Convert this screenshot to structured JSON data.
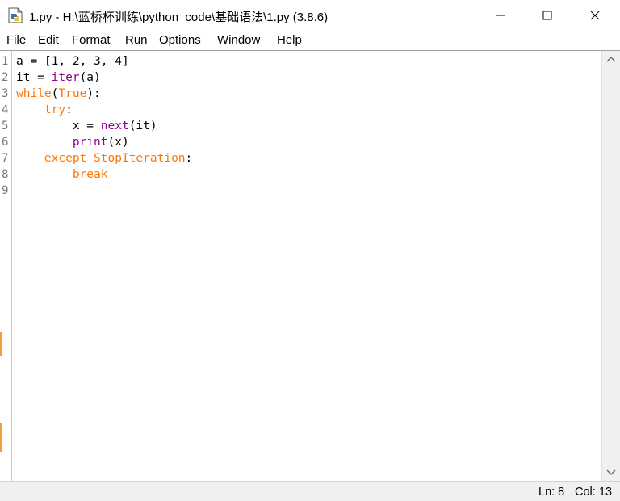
{
  "window": {
    "title": "1.py - H:\\蓝桥杯训练\\python_code\\基础语法\\1.py (3.8.6)",
    "icon": "python-file-icon"
  },
  "menu": [
    "File",
    "Edit",
    "Format",
    "Run",
    "Options",
    "Window",
    "Help"
  ],
  "gutter": {
    "line_numbers": [
      "1",
      "2",
      "3",
      "4",
      "5",
      "6",
      "7",
      "8",
      "9"
    ]
  },
  "code_lines": [
    [
      {
        "t": "a = [1, 2, 3, 4]",
        "c": ""
      }
    ],
    [
      {
        "t": "it = ",
        "c": ""
      },
      {
        "t": "iter",
        "c": "bi"
      },
      {
        "t": "(a)",
        "c": ""
      }
    ],
    [
      {
        "t": "while",
        "c": "kw"
      },
      {
        "t": "(",
        "c": ""
      },
      {
        "t": "True",
        "c": "kw"
      },
      {
        "t": "):",
        "c": ""
      }
    ],
    [
      {
        "t": "    ",
        "c": ""
      },
      {
        "t": "try",
        "c": "kw"
      },
      {
        "t": ":",
        "c": ""
      }
    ],
    [
      {
        "t": "        x = ",
        "c": ""
      },
      {
        "t": "next",
        "c": "bi"
      },
      {
        "t": "(it)",
        "c": ""
      }
    ],
    [
      {
        "t": "        ",
        "c": ""
      },
      {
        "t": "print",
        "c": "bi"
      },
      {
        "t": "(x)",
        "c": ""
      }
    ],
    [
      {
        "t": "    ",
        "c": ""
      },
      {
        "t": "except",
        "c": "kw"
      },
      {
        "t": " ",
        "c": ""
      },
      {
        "t": "StopIteration",
        "c": "kw"
      },
      {
        "t": ":",
        "c": ""
      }
    ],
    [
      {
        "t": "        ",
        "c": ""
      },
      {
        "t": "break",
        "c": "kw"
      }
    ],
    [
      {
        "t": "",
        "c": ""
      }
    ]
  ],
  "status": {
    "line": "Ln: 8",
    "column": "Col: 13"
  },
  "colors": {
    "keyword": "#ff7700",
    "builtin": "#900090",
    "text": "#000000"
  }
}
